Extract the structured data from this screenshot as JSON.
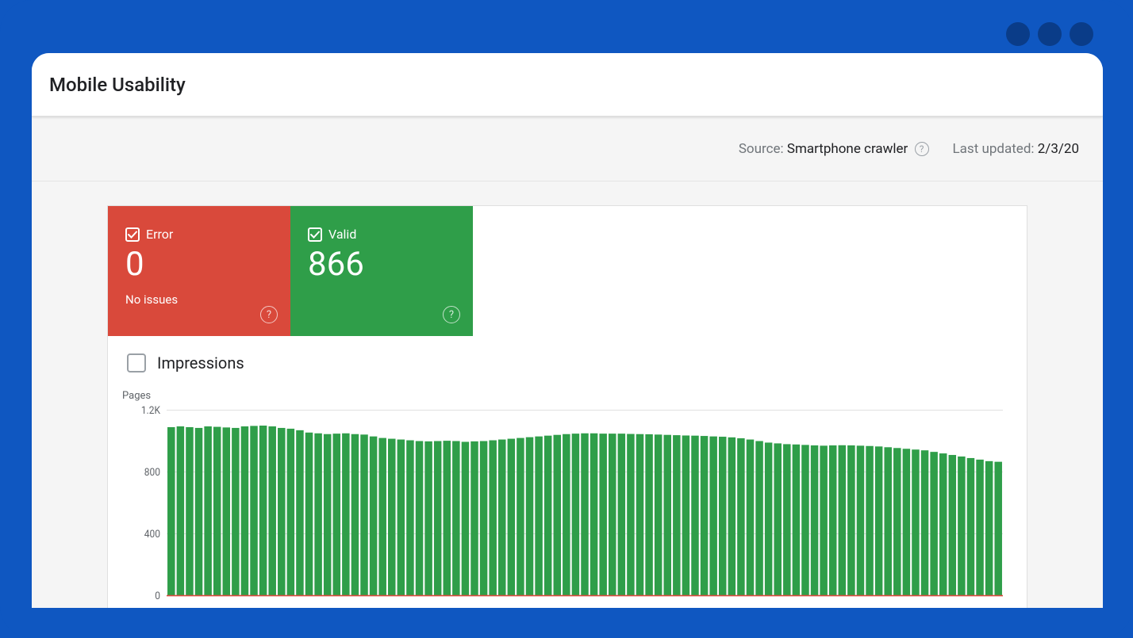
{
  "header": {
    "title": "Mobile Usability"
  },
  "meta": {
    "source_label": "Source: ",
    "source_value": "Smartphone crawler",
    "updated_label": "Last updated: ",
    "updated_value": "2/3/20"
  },
  "tiles": {
    "error": {
      "label": "Error",
      "value": "0",
      "sub": "No issues"
    },
    "valid": {
      "label": "Valid",
      "value": "866"
    }
  },
  "impressions": {
    "label": "Impressions",
    "checked": false
  },
  "chart_data": {
    "type": "bar",
    "title": "",
    "xlabel": "",
    "ylabel": "Pages",
    "ylim": [
      0,
      1200
    ],
    "yticks": [
      0,
      400,
      800,
      1200
    ],
    "ytick_labels": [
      "0",
      "400",
      "800",
      "1.2K"
    ],
    "series": [
      {
        "name": "Valid",
        "color": "#2f9e49",
        "values": [
          1090,
          1095,
          1090,
          1085,
          1095,
          1092,
          1088,
          1085,
          1095,
          1098,
          1100,
          1095,
          1085,
          1080,
          1070,
          1055,
          1050,
          1045,
          1048,
          1050,
          1045,
          1042,
          1030,
          1020,
          1015,
          1010,
          1005,
          1000,
          998,
          1000,
          1002,
          1000,
          995,
          998,
          1000,
          1005,
          1010,
          1015,
          1020,
          1025,
          1030,
          1035,
          1040,
          1045,
          1048,
          1050,
          1050,
          1048,
          1048,
          1048,
          1046,
          1045,
          1044,
          1042,
          1040,
          1038,
          1036,
          1035,
          1033,
          1030,
          1028,
          1024,
          1018,
          1010,
          1000,
          990,
          985,
          980,
          978,
          975,
          972,
          970,
          972,
          973,
          972,
          970,
          968,
          965,
          960,
          955,
          950,
          945,
          940,
          930,
          920,
          910,
          900,
          890,
          880,
          870,
          866
        ]
      },
      {
        "name": "Error",
        "color": "#d9493b",
        "values": [
          0,
          0,
          0,
          0,
          0,
          0,
          0,
          0,
          0,
          0,
          0,
          0,
          0,
          0,
          0,
          0,
          0,
          0,
          0,
          0,
          0,
          0,
          0,
          0,
          0,
          0,
          0,
          0,
          0,
          0,
          0,
          0,
          0,
          0,
          0,
          0,
          0,
          0,
          0,
          0,
          0,
          0,
          0,
          0,
          0,
          0,
          0,
          0,
          0,
          0,
          0,
          0,
          0,
          0,
          0,
          0,
          0,
          0,
          0,
          0,
          0,
          0,
          0,
          0,
          0,
          0,
          0,
          0,
          0,
          0,
          0,
          0,
          0,
          0,
          0,
          0,
          0,
          0,
          0,
          0,
          0,
          0,
          0,
          0,
          0,
          0,
          0,
          0,
          0,
          0,
          0
        ]
      }
    ]
  },
  "colors": {
    "error": "#d9493b",
    "valid": "#2f9e49",
    "frame": "#0f57c1"
  }
}
